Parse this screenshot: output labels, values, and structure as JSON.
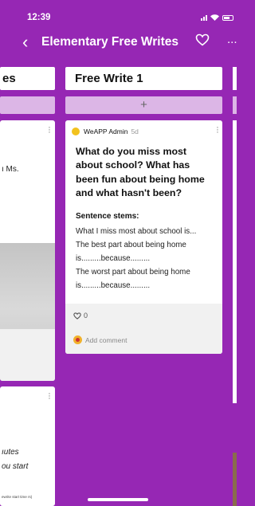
{
  "status": {
    "time": "12:39"
  },
  "nav": {
    "title": "Elementary Free Writes",
    "more": "..."
  },
  "left_column": {
    "header_fragment": "es",
    "card1_text": "ı Ms.",
    "card2_text1": "ıutes",
    "card2_text2": "ou start",
    "card2_fine": "ewrite start time rs)"
  },
  "main_column": {
    "header": "Free Write 1",
    "add_label": "+",
    "card": {
      "author": "WeAPP Admin",
      "time": "5d",
      "question": "What do you miss most about school? What has been fun about being home and what hasn't been?",
      "stems_title": "Sentence stems:",
      "stems": [
        "What I miss most about school is...",
        "The best part about being home",
        "is.........because.........",
        "The worst part about being home",
        "is.........because........."
      ],
      "likes": "0",
      "comment_placeholder": "Add comment"
    }
  },
  "colors": {
    "background": "#9627b4",
    "add_bar": "#dcb6e6",
    "avatar": "#f2c21e"
  },
  "icons": [
    "back-chevron-icon",
    "heart-icon",
    "more-icon",
    "kebab-icon",
    "like-heart-icon",
    "emoji-icon"
  ]
}
